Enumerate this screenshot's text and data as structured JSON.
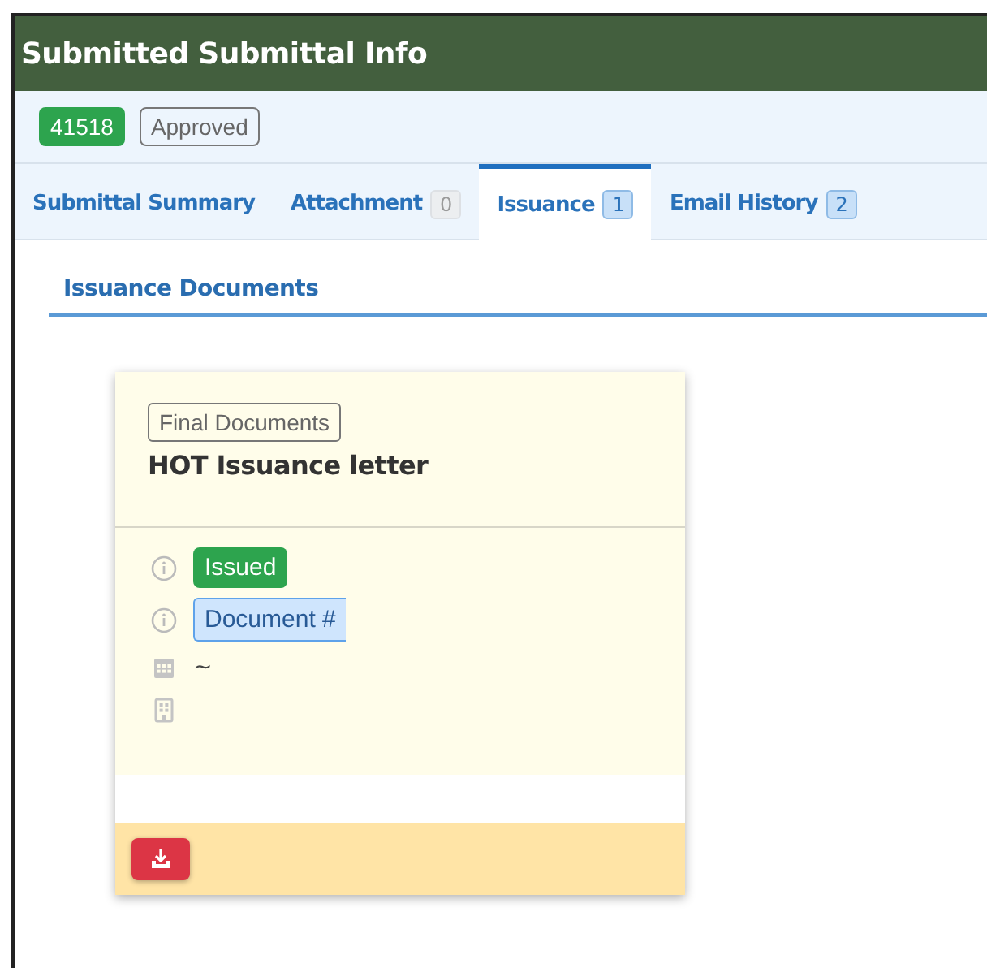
{
  "header": {
    "title": "Submitted Submittal Info"
  },
  "badges": [
    {
      "kind": "id",
      "text": "41518"
    },
    {
      "kind": "status",
      "text": "Approved"
    }
  ],
  "tabs": [
    {
      "label": "Submittal Summary",
      "selected": false
    },
    {
      "label": "Attachment",
      "count": "0",
      "count_disabled": true,
      "selected": false
    },
    {
      "label": "Issuance",
      "count": "1",
      "count_disabled": false,
      "selected": true
    },
    {
      "label": "Email History",
      "count": "2",
      "count_disabled": false,
      "selected": false
    }
  ],
  "section": {
    "title": "Issuance Documents"
  },
  "card": {
    "category": "Final Documents",
    "title": "HOT Issuance letter",
    "rows": [
      {
        "kind": "status",
        "text": "Issued"
      },
      {
        "kind": "document",
        "text": "Document #"
      },
      {
        "kind": "date",
        "text": "~"
      },
      {
        "kind": "location"
      }
    ]
  }
}
